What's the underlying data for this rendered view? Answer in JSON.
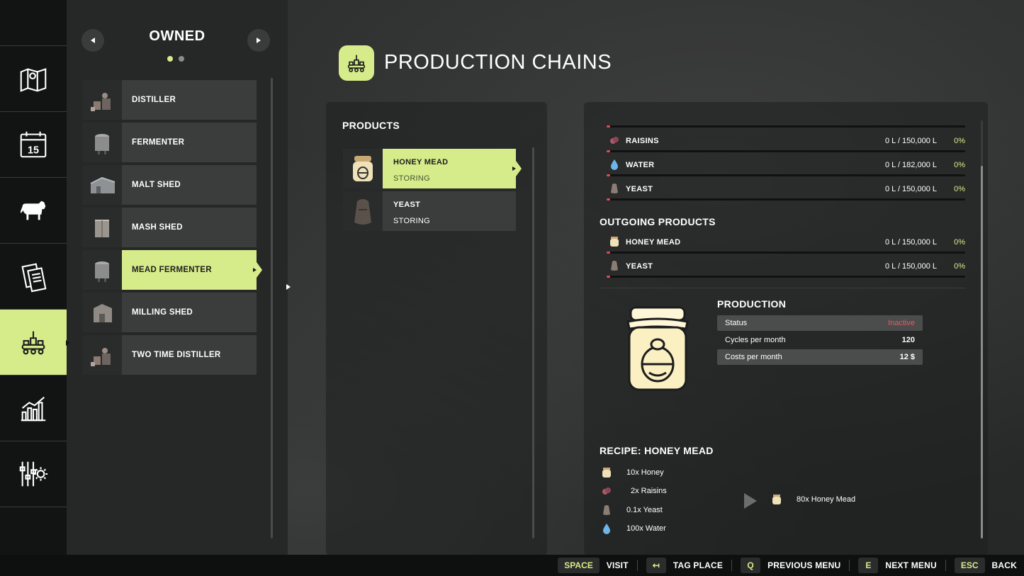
{
  "owned": {
    "title": "OWNED",
    "items": [
      {
        "label": "DISTILLER"
      },
      {
        "label": "FERMENTER"
      },
      {
        "label": "MALT SHED"
      },
      {
        "label": "MASH SHED"
      },
      {
        "label": "MEAD FERMENTER"
      },
      {
        "label": "MILLING SHED"
      },
      {
        "label": "TWO TIME DISTILLER"
      }
    ]
  },
  "header": {
    "title": "PRODUCTION CHAINS"
  },
  "products": {
    "title": "PRODUCTS",
    "items": [
      {
        "name": "HONEY MEAD",
        "status": "STORING"
      },
      {
        "name": "YEAST",
        "status": "STORING"
      }
    ]
  },
  "incoming": [
    {
      "name": "RAISINS",
      "amount": "0 L / 150,000 L",
      "percent": "0%",
      "fill": 0.0
    },
    {
      "name": "WATER",
      "amount": "0 L / 182,000 L",
      "percent": "0%",
      "fill": 0.0
    },
    {
      "name": "YEAST",
      "amount": "0 L / 150,000 L",
      "percent": "0%",
      "fill": 0.0
    }
  ],
  "outgoing": {
    "title": "OUTGOING PRODUCTS",
    "items": [
      {
        "name": "HONEY MEAD",
        "amount": "0 L / 150,000 L",
        "percent": "0%",
        "fill": 0.0
      },
      {
        "name": "YEAST",
        "amount": "0 L / 150,000 L",
        "percent": "0%",
        "fill": 0.0
      }
    ]
  },
  "production": {
    "title": "PRODUCTION",
    "status_label": "Status",
    "status_value": "Inactive",
    "cycles_label": "Cycles per month",
    "cycles_value": "120",
    "costs_label": "Costs per month",
    "costs_value": "12 $"
  },
  "recipe": {
    "title": "RECIPE: HONEY MEAD",
    "inputs": [
      "10x Honey",
      "2x Raisins",
      "0.1x Yeast",
      "100x Water"
    ],
    "output": "80x Honey Mead"
  },
  "hints": [
    {
      "key": "SPACE",
      "label": "VISIT"
    },
    {
      "key": "↤",
      "label": "TAG PLACE"
    },
    {
      "key": "Q",
      "label": "PREVIOUS MENU"
    },
    {
      "key": "E",
      "label": "NEXT MENU"
    },
    {
      "key": "ESC",
      "label": "BACK"
    }
  ],
  "colors": {
    "accent": "#d6ec8a",
    "alert": "#e75a69"
  }
}
